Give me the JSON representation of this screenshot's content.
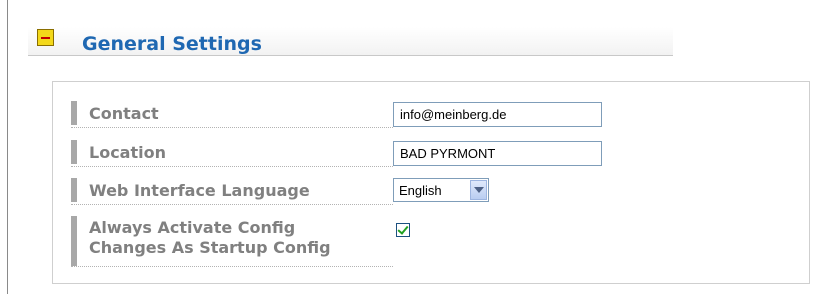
{
  "section": {
    "title": "General Settings",
    "collapse_icon": "minus-icon"
  },
  "fields": {
    "contact": {
      "label": "Contact",
      "value": "info@meinberg.de"
    },
    "location": {
      "label": "Location",
      "value": "BAD PYRMONT"
    },
    "language": {
      "label": "Web Interface Language",
      "value": "English"
    },
    "startup": {
      "label_line1": "Always Activate Config",
      "label_line2": "Changes As Startup Config",
      "checked": true
    }
  },
  "colors": {
    "title": "#1f68b2",
    "label": "#808080",
    "checkmark": "#21a121",
    "collapse_button": "#f3d81a"
  }
}
